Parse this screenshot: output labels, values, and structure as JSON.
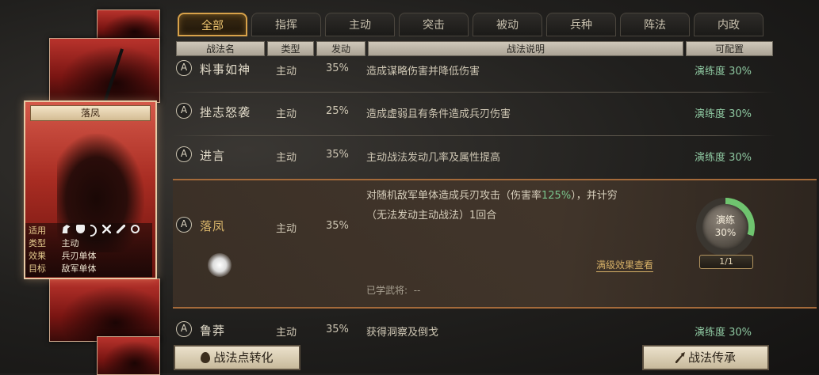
{
  "tabs": [
    {
      "label": "全部",
      "active": true
    },
    {
      "label": "指挥",
      "active": false
    },
    {
      "label": "主动",
      "active": false
    },
    {
      "label": "突击",
      "active": false
    },
    {
      "label": "被动",
      "active": false
    },
    {
      "label": "兵种",
      "active": false
    },
    {
      "label": "阵法",
      "active": false
    },
    {
      "label": "内政",
      "active": false
    }
  ],
  "table_headers": {
    "name": "战法名",
    "type": "类型",
    "rate": "发动",
    "desc": "战法说明",
    "config": "可配置"
  },
  "rows": [
    {
      "badge": "A",
      "name": "料事如神",
      "type": "主动",
      "rate": "35%",
      "desc": "造成谋略伤害并降低伤害",
      "level": "演练度 30%"
    },
    {
      "badge": "A",
      "name": "挫志怒袭",
      "type": "主动",
      "rate": "25%",
      "desc": "造成虚弱且有条件造成兵刃伤害",
      "level": "演练度 30%"
    },
    {
      "badge": "A",
      "name": "进言",
      "type": "主动",
      "rate": "35%",
      "desc": "主动战法发动几率及属性提高",
      "level": "演练度 30%"
    },
    {
      "badge": "A",
      "name": "鲁莽",
      "type": "主动",
      "rate": "35%",
      "desc": "获得洞察及倒戈",
      "level": "演练度 30%"
    }
  ],
  "selected": {
    "badge": "A",
    "name": "落凤",
    "type": "主动",
    "rate": "35%",
    "desc_line1_pre": "对随机敌军单体造成兵刃攻击（伤害率",
    "desc_line1_value": "125%",
    "desc_line1_post": "），并计穷",
    "desc_line2": "（无法发动主动战法）1回合",
    "full_effect": "满级效果查看",
    "learned_label": "已学武将:",
    "learned_value": "--",
    "train_label": "演练",
    "train_percent": "30%",
    "train_progress": 0.3,
    "train_count": "1/1"
  },
  "card": {
    "name": "落凤",
    "info": [
      {
        "key": "适用",
        "icons": [
          "horse-icon",
          "shield-icon",
          "bow-icon",
          "cross-weapon-icon",
          "spear-icon",
          "wheel-icon"
        ]
      },
      {
        "key": "类型",
        "value": "主动"
      },
      {
        "key": "效果",
        "value": "兵刃单体"
      },
      {
        "key": "目标",
        "value": "敌军单体"
      }
    ]
  },
  "buttons": {
    "convert": "战法点转化",
    "inherit": "战法传承"
  },
  "colors": {
    "accent": "#d8a24a",
    "level_green": "#8fc9a2",
    "card_red": "#a82c22"
  }
}
